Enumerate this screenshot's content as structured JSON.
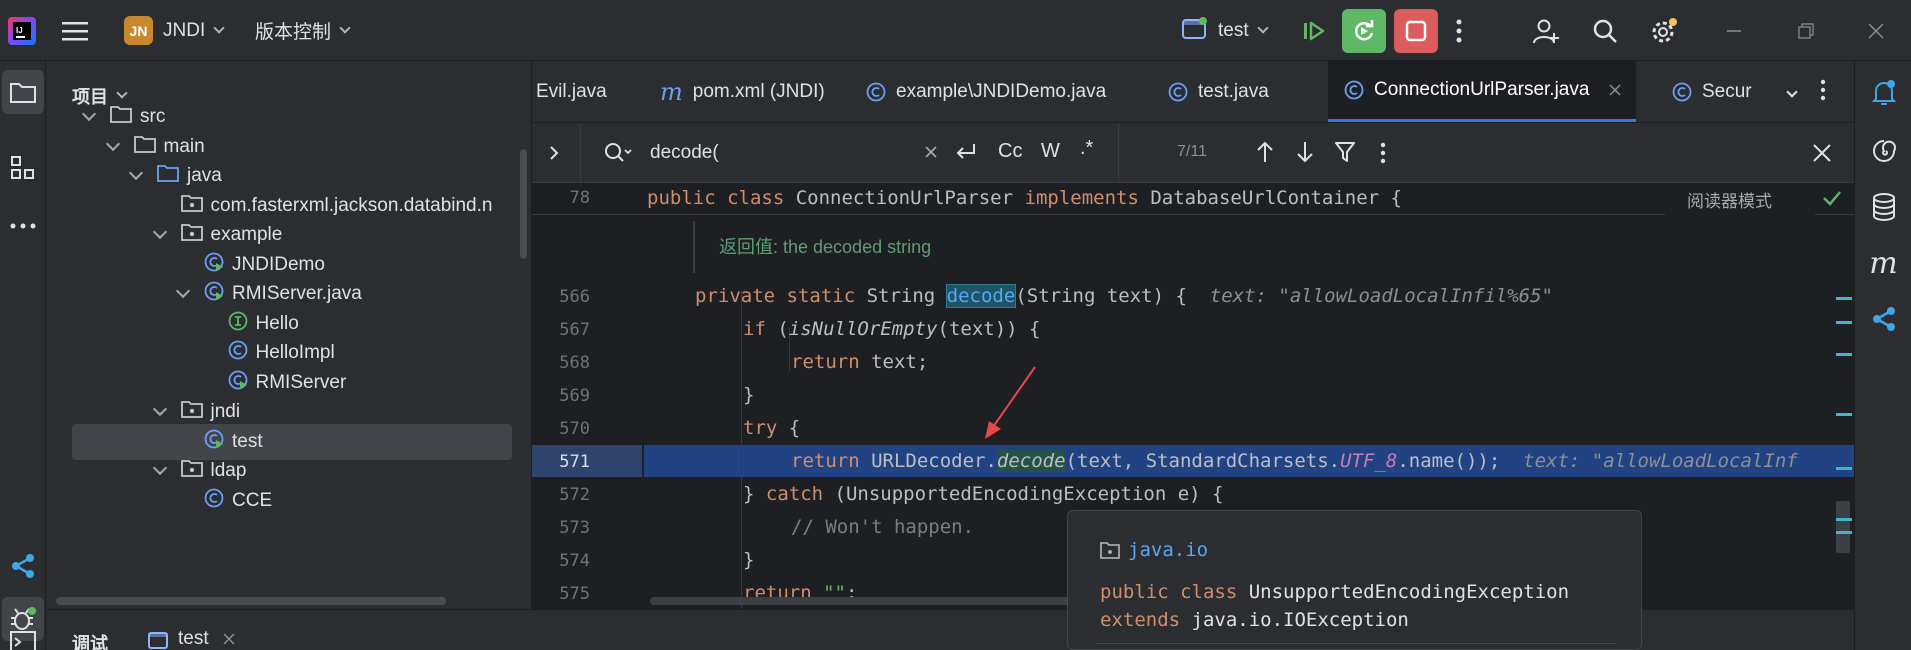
{
  "titlebar": {
    "project_badge": "JN",
    "project_name": "JNDI",
    "vcs_label": "版本控制",
    "run_config": "test",
    "icons": [
      "app-logo-icon",
      "hamburger-menu-icon",
      "run-config-icon",
      "resume-icon",
      "rerun-icon",
      "stop-icon",
      "more-vert-icon",
      "add-user-icon",
      "search-icon",
      "settings-icon",
      "minimize-icon",
      "restore-icon",
      "close-icon"
    ]
  },
  "project_panel": {
    "title": "项目",
    "tree": [
      {
        "label": "src",
        "depth": 0,
        "kind": "folder",
        "expanded": true
      },
      {
        "label": "main",
        "depth": 1,
        "kind": "folder",
        "expanded": true
      },
      {
        "label": "java",
        "depth": 2,
        "kind": "source-folder",
        "expanded": true
      },
      {
        "label": "com.fasterxml.jackson.databind.n",
        "depth": 3,
        "kind": "package",
        "expanded": false
      },
      {
        "label": "example",
        "depth": 3,
        "kind": "package",
        "expanded": true
      },
      {
        "label": "JNDIDemo",
        "depth": 4,
        "kind": "class-run",
        "expanded": false
      },
      {
        "label": "RMIServer.java",
        "depth": 4,
        "kind": "class-run",
        "expanded": true
      },
      {
        "label": "Hello",
        "depth": 5,
        "kind": "interface",
        "expanded": false
      },
      {
        "label": "HelloImpl",
        "depth": 5,
        "kind": "class",
        "expanded": false
      },
      {
        "label": "RMIServer",
        "depth": 5,
        "kind": "class-run",
        "expanded": false
      },
      {
        "label": "jndi",
        "depth": 3,
        "kind": "package",
        "expanded": true
      },
      {
        "label": "test",
        "depth": 4,
        "kind": "class-run",
        "expanded": false,
        "selected": true
      },
      {
        "label": "ldap",
        "depth": 3,
        "kind": "package",
        "expanded": true
      },
      {
        "label": "CCE",
        "depth": 4,
        "kind": "class",
        "expanded": false
      }
    ]
  },
  "tabs": [
    {
      "label": "Evil.java",
      "icon": "java-class-icon"
    },
    {
      "label": "pom.xml (JNDI)",
      "icon": "maven-icon"
    },
    {
      "label": "example\\JNDIDemo.java",
      "icon": "java-class-icon"
    },
    {
      "label": "test.java",
      "icon": "java-class-icon"
    },
    {
      "label": "ConnectionUrlParser.java",
      "icon": "java-class-icon",
      "active": true
    },
    {
      "label": "Secur",
      "icon": "java-class-icon"
    }
  ],
  "search": {
    "query": "decode(",
    "match_case": "Cc",
    "words": "W",
    "regex": ".*",
    "count": "7/11"
  },
  "editor": {
    "reader_mode": "阅读器模式",
    "sticky_line_number": "78",
    "doc_return": "返回值: the decoded string",
    "line_numbers": [
      "566",
      "567",
      "568",
      "569",
      "570",
      "571",
      "572",
      "573",
      "574",
      "575"
    ],
    "hint_text_param": "text: \"allowLoadLocalInfil%65\"",
    "hint_text_return": "text: \"allowLoadLocalInf",
    "comment": "// Won't happen."
  },
  "popup": {
    "package": "java.io",
    "line1_kw": "public class",
    "line1_name": "UnsupportedEncodingException",
    "line2_kw": "extends",
    "line2_name": "java.io.IOException"
  },
  "bottom": {
    "debug_label": "调试",
    "session_tab": "test"
  },
  "colors": {
    "accent": "#3574f0",
    "keyword": "#cf8e6d",
    "function": "#56a8f5",
    "comment": "#7a7e85",
    "string": "#6aab73",
    "stop_red": "#db5c5c",
    "rerun_green": "#5fb865",
    "annotation_arrow": "#e5484d"
  }
}
